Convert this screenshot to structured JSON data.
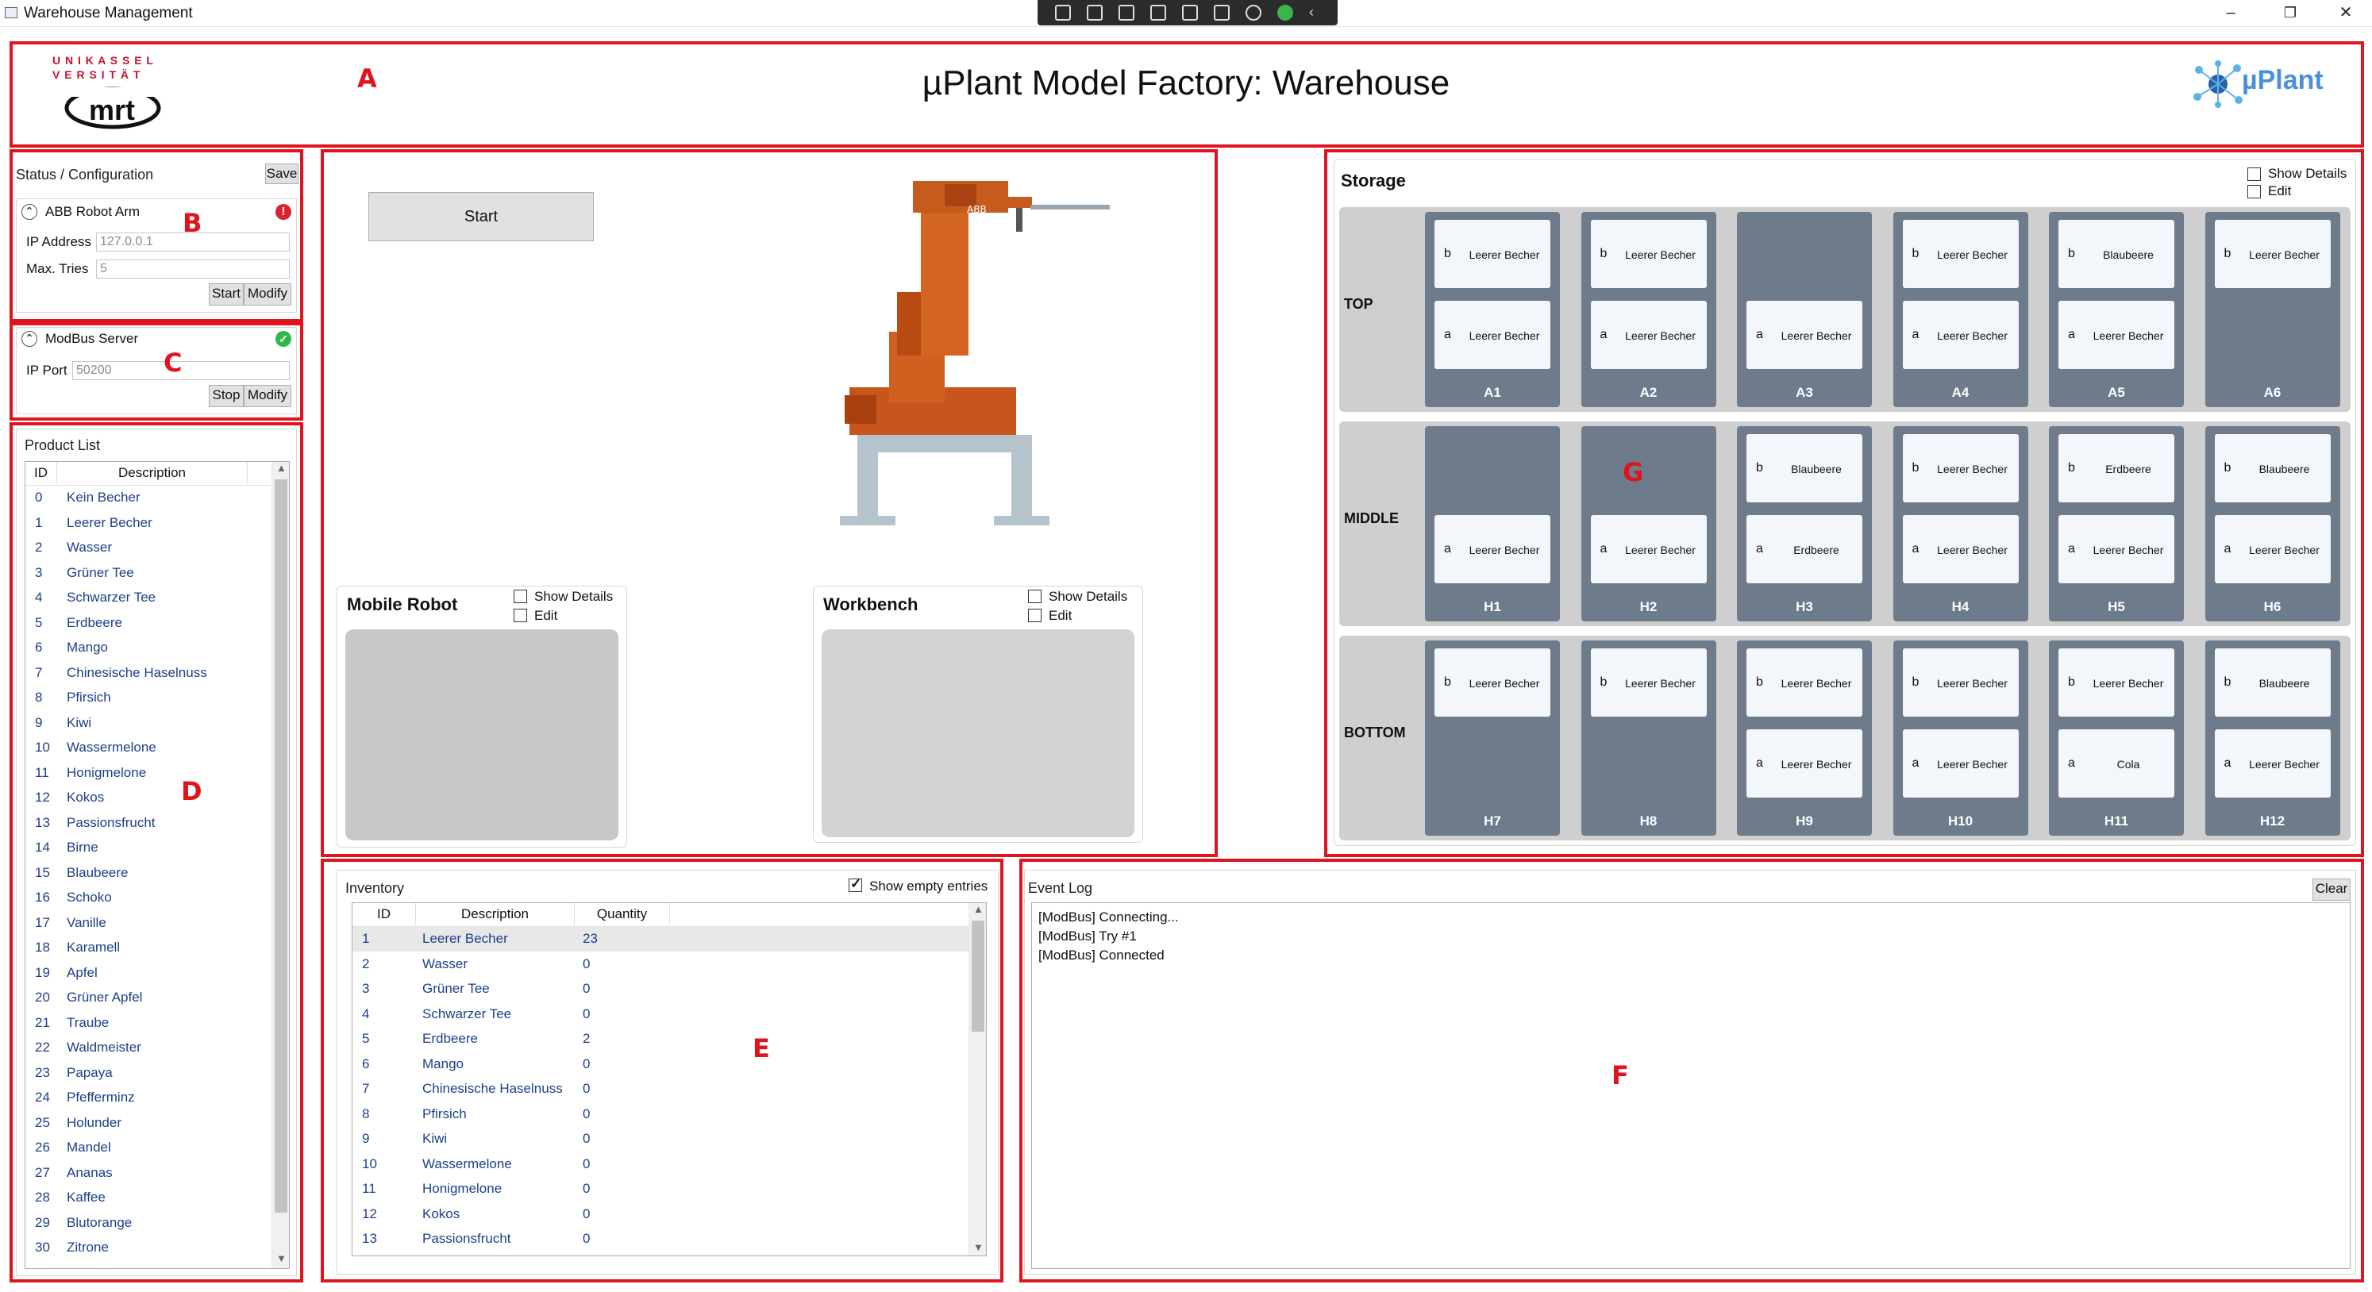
{
  "window": {
    "title": "Warehouse Management",
    "minimize": "–",
    "maximize": "❐",
    "close": "✕"
  },
  "header": {
    "title": "µPlant Model Factory: Warehouse",
    "logo_left_top": "U N I K A S S E L",
    "logo_left_mid": "V E R S I T Ä T",
    "logo_left_brand": "mrt",
    "logo_right": "µPlant"
  },
  "region_labels": {
    "a": "A",
    "b": "B",
    "c": "C",
    "d": "D",
    "e": "E",
    "f": "F",
    "g": "G"
  },
  "status_config": {
    "title": "Status / Configuration",
    "save_label": "Save",
    "robot": {
      "title": "ABB Robot Arm",
      "ip_label": "IP Address",
      "ip_value": "127.0.0.1",
      "tries_label": "Max. Tries",
      "tries_value": "5",
      "start_label": "Start",
      "modify_label": "Modify",
      "status_color": "#d9232e"
    },
    "modbus": {
      "title": "ModBus Server",
      "port_label": "IP Port",
      "port_value": "50200",
      "stop_label": "Stop",
      "modify_label": "Modify",
      "status_color": "#2fb84a"
    }
  },
  "product_list": {
    "title": "Product List",
    "col_id": "ID",
    "col_desc": "Description",
    "items": [
      {
        "id": "0",
        "desc": "Kein Becher"
      },
      {
        "id": "1",
        "desc": "Leerer Becher"
      },
      {
        "id": "2",
        "desc": "Wasser"
      },
      {
        "id": "3",
        "desc": "Grüner Tee"
      },
      {
        "id": "4",
        "desc": "Schwarzer Tee"
      },
      {
        "id": "5",
        "desc": "Erdbeere"
      },
      {
        "id": "6",
        "desc": "Mango"
      },
      {
        "id": "7",
        "desc": "Chinesische Haselnuss"
      },
      {
        "id": "8",
        "desc": "Pfirsich"
      },
      {
        "id": "9",
        "desc": "Kiwi"
      },
      {
        "id": "10",
        "desc": "Wassermelone"
      },
      {
        "id": "11",
        "desc": "Honigmelone"
      },
      {
        "id": "12",
        "desc": "Kokos"
      },
      {
        "id": "13",
        "desc": "Passionsfrucht"
      },
      {
        "id": "14",
        "desc": "Birne"
      },
      {
        "id": "15",
        "desc": "Blaubeere"
      },
      {
        "id": "16",
        "desc": "Schoko"
      },
      {
        "id": "17",
        "desc": "Vanille"
      },
      {
        "id": "18",
        "desc": "Karamell"
      },
      {
        "id": "19",
        "desc": "Apfel"
      },
      {
        "id": "20",
        "desc": "Grüner Apfel"
      },
      {
        "id": "21",
        "desc": "Traube"
      },
      {
        "id": "22",
        "desc": "Waldmeister"
      },
      {
        "id": "23",
        "desc": "Papaya"
      },
      {
        "id": "24",
        "desc": "Pfefferminz"
      },
      {
        "id": "25",
        "desc": "Holunder"
      },
      {
        "id": "26",
        "desc": "Mandel"
      },
      {
        "id": "27",
        "desc": "Ananas"
      },
      {
        "id": "28",
        "desc": "Kaffee"
      },
      {
        "id": "29",
        "desc": "Blutorange"
      },
      {
        "id": "30",
        "desc": "Zitrone"
      }
    ]
  },
  "robot_area": {
    "start_label": "Start",
    "mobile_robot": {
      "title": "Mobile Robot",
      "show_details": "Show Details",
      "edit": "Edit"
    },
    "workbench": {
      "title": "Workbench",
      "show_details": "Show Details",
      "edit": "Edit"
    }
  },
  "storage": {
    "title": "Storage",
    "show_details": "Show Details",
    "edit": "Edit",
    "rows": [
      {
        "label": "TOP",
        "slots": [
          {
            "name": "A1",
            "b": "Leerer Becher",
            "a": "Leerer Becher"
          },
          {
            "name": "A2",
            "b": "Leerer Becher",
            "a": "Leerer Becher"
          },
          {
            "name": "A3",
            "b": null,
            "a": "Leerer Becher"
          },
          {
            "name": "A4",
            "b": "Leerer Becher",
            "a": "Leerer Becher"
          },
          {
            "name": "A5",
            "b": "Blaubeere",
            "a": "Leerer Becher"
          },
          {
            "name": "A6",
            "b": "Leerer Becher",
            "a": null
          }
        ]
      },
      {
        "label": "MIDDLE",
        "slots": [
          {
            "name": "H1",
            "b": null,
            "a": "Leerer Becher"
          },
          {
            "name": "H2",
            "b": null,
            "a": "Leerer Becher"
          },
          {
            "name": "H3",
            "b": "Blaubeere",
            "a": "Erdbeere"
          },
          {
            "name": "H4",
            "b": "Leerer Becher",
            "a": "Leerer Becher"
          },
          {
            "name": "H5",
            "b": "Erdbeere",
            "a": "Leerer Becher"
          },
          {
            "name": "H6",
            "b": "Blaubeere",
            "a": "Leerer Becher"
          }
        ]
      },
      {
        "label": "BOTTOM",
        "slots": [
          {
            "name": "H7",
            "b": "Leerer Becher",
            "a": null
          },
          {
            "name": "H8",
            "b": "Leerer Becher",
            "a": null
          },
          {
            "name": "H9",
            "b": "Leerer Becher",
            "a": "Leerer Becher"
          },
          {
            "name": "H10",
            "b": "Leerer Becher",
            "a": "Leerer Becher"
          },
          {
            "name": "H11",
            "b": "Leerer Becher",
            "a": "Cola"
          },
          {
            "name": "H12",
            "b": "Blaubeere",
            "a": "Leerer Becher"
          }
        ]
      }
    ]
  },
  "inventory": {
    "title": "Inventory",
    "show_empty": "Show empty entries",
    "col_id": "ID",
    "col_desc": "Description",
    "col_qty": "Quantity",
    "items": [
      {
        "id": "1",
        "desc": "Leerer Becher",
        "qty": "23"
      },
      {
        "id": "2",
        "desc": "Wasser",
        "qty": "0"
      },
      {
        "id": "3",
        "desc": "Grüner Tee",
        "qty": "0"
      },
      {
        "id": "4",
        "desc": "Schwarzer Tee",
        "qty": "0"
      },
      {
        "id": "5",
        "desc": "Erdbeere",
        "qty": "2"
      },
      {
        "id": "6",
        "desc": "Mango",
        "qty": "0"
      },
      {
        "id": "7",
        "desc": "Chinesische Haselnuss",
        "qty": "0"
      },
      {
        "id": "8",
        "desc": "Pfirsich",
        "qty": "0"
      },
      {
        "id": "9",
        "desc": "Kiwi",
        "qty": "0"
      },
      {
        "id": "10",
        "desc": "Wassermelone",
        "qty": "0"
      },
      {
        "id": "11",
        "desc": "Honigmelone",
        "qty": "0"
      },
      {
        "id": "12",
        "desc": "Kokos",
        "qty": "0"
      },
      {
        "id": "13",
        "desc": "Passionsfrucht",
        "qty": "0"
      }
    ]
  },
  "event_log": {
    "title": "Event Log",
    "clear_label": "Clear",
    "lines": [
      "[ModBus] Connecting...",
      "[ModBus] Try #1",
      "[ModBus] Connected"
    ]
  }
}
